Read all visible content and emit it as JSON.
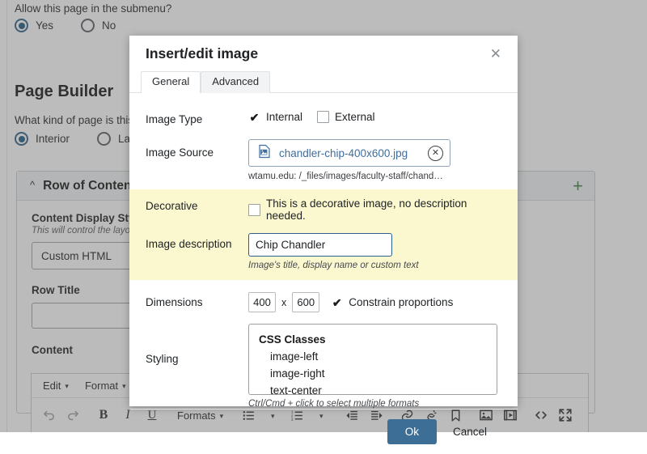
{
  "background": {
    "submenu_question": "Allow this page in the submenu?",
    "submenu_options": [
      {
        "label": "Yes",
        "selected": true
      },
      {
        "label": "No",
        "selected": false
      }
    ],
    "section_heading": "Page Builder",
    "page_kind_question": "What kind of page is this?",
    "page_kind_options": [
      {
        "label": "Interior",
        "selected": true
      },
      {
        "label": "Landing",
        "selected": false
      }
    ],
    "row_card": {
      "title": "Row of Content",
      "collapse_icon": "chevron-up-icon",
      "add_icon": "plus-icon",
      "add_color": "#3f7d45",
      "display_style_label": "Content Display Style",
      "display_style_help": "This will control the layout",
      "display_style_value": "Custom HTML",
      "row_title_label": "Row Title",
      "row_title_value": "",
      "content_label": "Content"
    },
    "editor": {
      "menu": [
        {
          "label": "Edit",
          "caret": "▾"
        },
        {
          "label": "Format",
          "caret": "▾"
        }
      ],
      "toolbar": [
        {
          "name": "undo-icon",
          "glyph": "↩",
          "dim": true
        },
        {
          "name": "redo-icon",
          "glyph": "↪",
          "dim": true
        },
        {
          "name": "bold-icon",
          "glyph": "B",
          "style": "b-bold"
        },
        {
          "name": "italic-icon",
          "glyph": "I",
          "style": "b-ital"
        },
        {
          "name": "underline-icon",
          "glyph": "U",
          "style": "b-und"
        },
        {
          "name": "formats-menu",
          "glyph": "Formats",
          "text": true,
          "caret": "▾"
        },
        {
          "name": "bullet-list-icon",
          "glyph": "bullist"
        },
        {
          "name": "numbered-list-icon",
          "glyph": "numlist"
        },
        {
          "name": "outdent-icon",
          "glyph": "outdent"
        },
        {
          "name": "indent-icon",
          "glyph": "indent"
        },
        {
          "name": "link-icon",
          "glyph": "link"
        },
        {
          "name": "unlink-icon",
          "glyph": "unlink"
        },
        {
          "name": "anchor-icon",
          "glyph": "anchor"
        },
        {
          "name": "insert-image-icon",
          "glyph": "image"
        },
        {
          "name": "insert-media-icon",
          "glyph": "media"
        },
        {
          "name": "source-code-icon",
          "glyph": "code"
        },
        {
          "name": "fullscreen-icon",
          "glyph": "fullscreen"
        }
      ]
    }
  },
  "dialog": {
    "title": "Insert/edit image",
    "close_icon": "close-icon",
    "tabs": [
      {
        "label": "General",
        "active": true
      },
      {
        "label": "Advanced",
        "active": false
      }
    ],
    "fields": {
      "image_type": {
        "label": "Image Type",
        "options": [
          {
            "label": "Internal",
            "checked": true
          },
          {
            "label": "External",
            "checked": false
          }
        ]
      },
      "image_source": {
        "label": "Image Source",
        "file_icon": "image-file-icon",
        "filename": "chandler-chip-400x600.jpg",
        "clear_icon": "clear-circle-icon",
        "path": "wtamu.edu: /_files/images/faculty-staff/chand…",
        "link_color": "#3f6e9e"
      },
      "decorative": {
        "label": "Decorative",
        "checkbox_label": "This is a decorative image, no description needed.",
        "checked": false
      },
      "image_description": {
        "label": "Image description",
        "value": "Chip Chandler",
        "help": "Image's title, display name or custom text"
      },
      "dimensions": {
        "label": "Dimensions",
        "width": "400",
        "separator": "x",
        "height": "600",
        "constrain_label": "Constrain proportions",
        "constrain_checked": true
      },
      "styling": {
        "label": "Styling",
        "group_label": "CSS Classes",
        "options": [
          "image-left",
          "image-right",
          "text-center"
        ],
        "help": "Ctrl/Cmd + click to select multiple formats"
      }
    },
    "highlight_color": "#fbf8cf",
    "buttons": {
      "ok": "Ok",
      "cancel": "Cancel",
      "ok_color": "#3d6e96"
    }
  }
}
